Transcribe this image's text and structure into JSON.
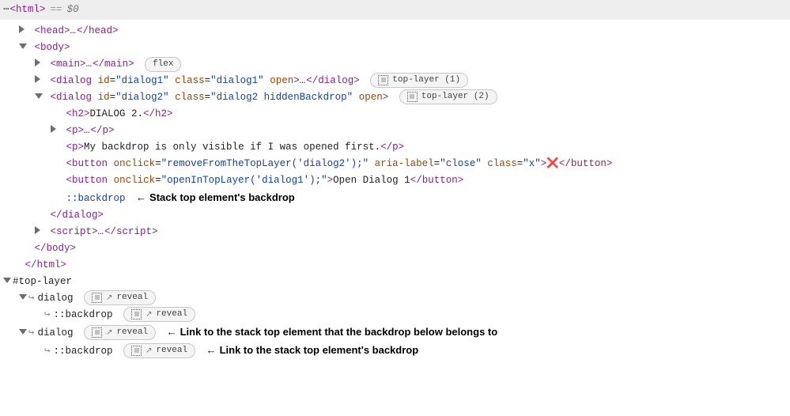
{
  "header": {
    "ellipsis": "⋯",
    "html_open": "<html>",
    "eq": "==",
    "dollar": "$0"
  },
  "nodes": {
    "head": {
      "open": "<head>",
      "close": "</head>",
      "ell": "…"
    },
    "body": {
      "open": "<body>",
      "close": "</body>"
    },
    "main": {
      "open": "<main>",
      "close": "</main>",
      "ell": "…",
      "badge": "flex"
    },
    "dialog1": {
      "tag": "dialog",
      "open": "<",
      "close": ">",
      "id_attr": "id",
      "id_val": "\"dialog1\"",
      "class_attr": "class",
      "class_val": "\"dialog1\"",
      "open_attr": "open",
      "ell": "…",
      "closing": "</dialog>",
      "badge": "top-layer (1)"
    },
    "dialog2": {
      "tag": "dialog",
      "open": "<",
      "close": ">",
      "id_attr": "id",
      "id_val": "\"dialog2\"",
      "class_attr": "class",
      "class_val": "\"dialog2 hiddenBackdrop\"",
      "open_attr": "open",
      "closing": "</dialog>",
      "badge": "top-layer (2)"
    },
    "h2": {
      "open": "<h2>",
      "text": "DIALOG 2.",
      "close": "</h2>"
    },
    "p1": {
      "open": "<p>",
      "ell": "…",
      "close": "</p>"
    },
    "p2": {
      "open": "<p>",
      "text": "My backdrop is only visible if I was opened first.",
      "close": "</p>"
    },
    "btn1": {
      "open": "<",
      "tag": "button",
      "onclick_attr": "onclick",
      "onclick_val": "\"removeFromTheTopLayer('dialog2');\"",
      "aria_attr": "aria-label",
      "aria_val": "\"close\"",
      "class_attr": "class",
      "class_val": "\"x\"",
      "gt": ">",
      "text": "❌",
      "close": "</button>"
    },
    "btn2": {
      "open": "<",
      "tag": "button",
      "onclick_attr": "onclick",
      "onclick_val": "\"openInTopLayer('dialog1');\"",
      "gt": ">",
      "text": "Open Dialog 1",
      "close": "</button>"
    },
    "backdrop_pseudo": "::backdrop",
    "backdrop_annot": "Stack top element's backdrop",
    "script": {
      "open": "<script>",
      "ell": "…",
      "close": "</script>"
    },
    "html_close": "</html>"
  },
  "top_layer": {
    "root": "#top-layer",
    "dialog": "dialog",
    "backdrop": "::backdrop",
    "reveal": "reveal",
    "annot1": "Link to the stack top element that the backdrop below belongs to",
    "annot2": "Link to the stack top element's backdrop"
  }
}
